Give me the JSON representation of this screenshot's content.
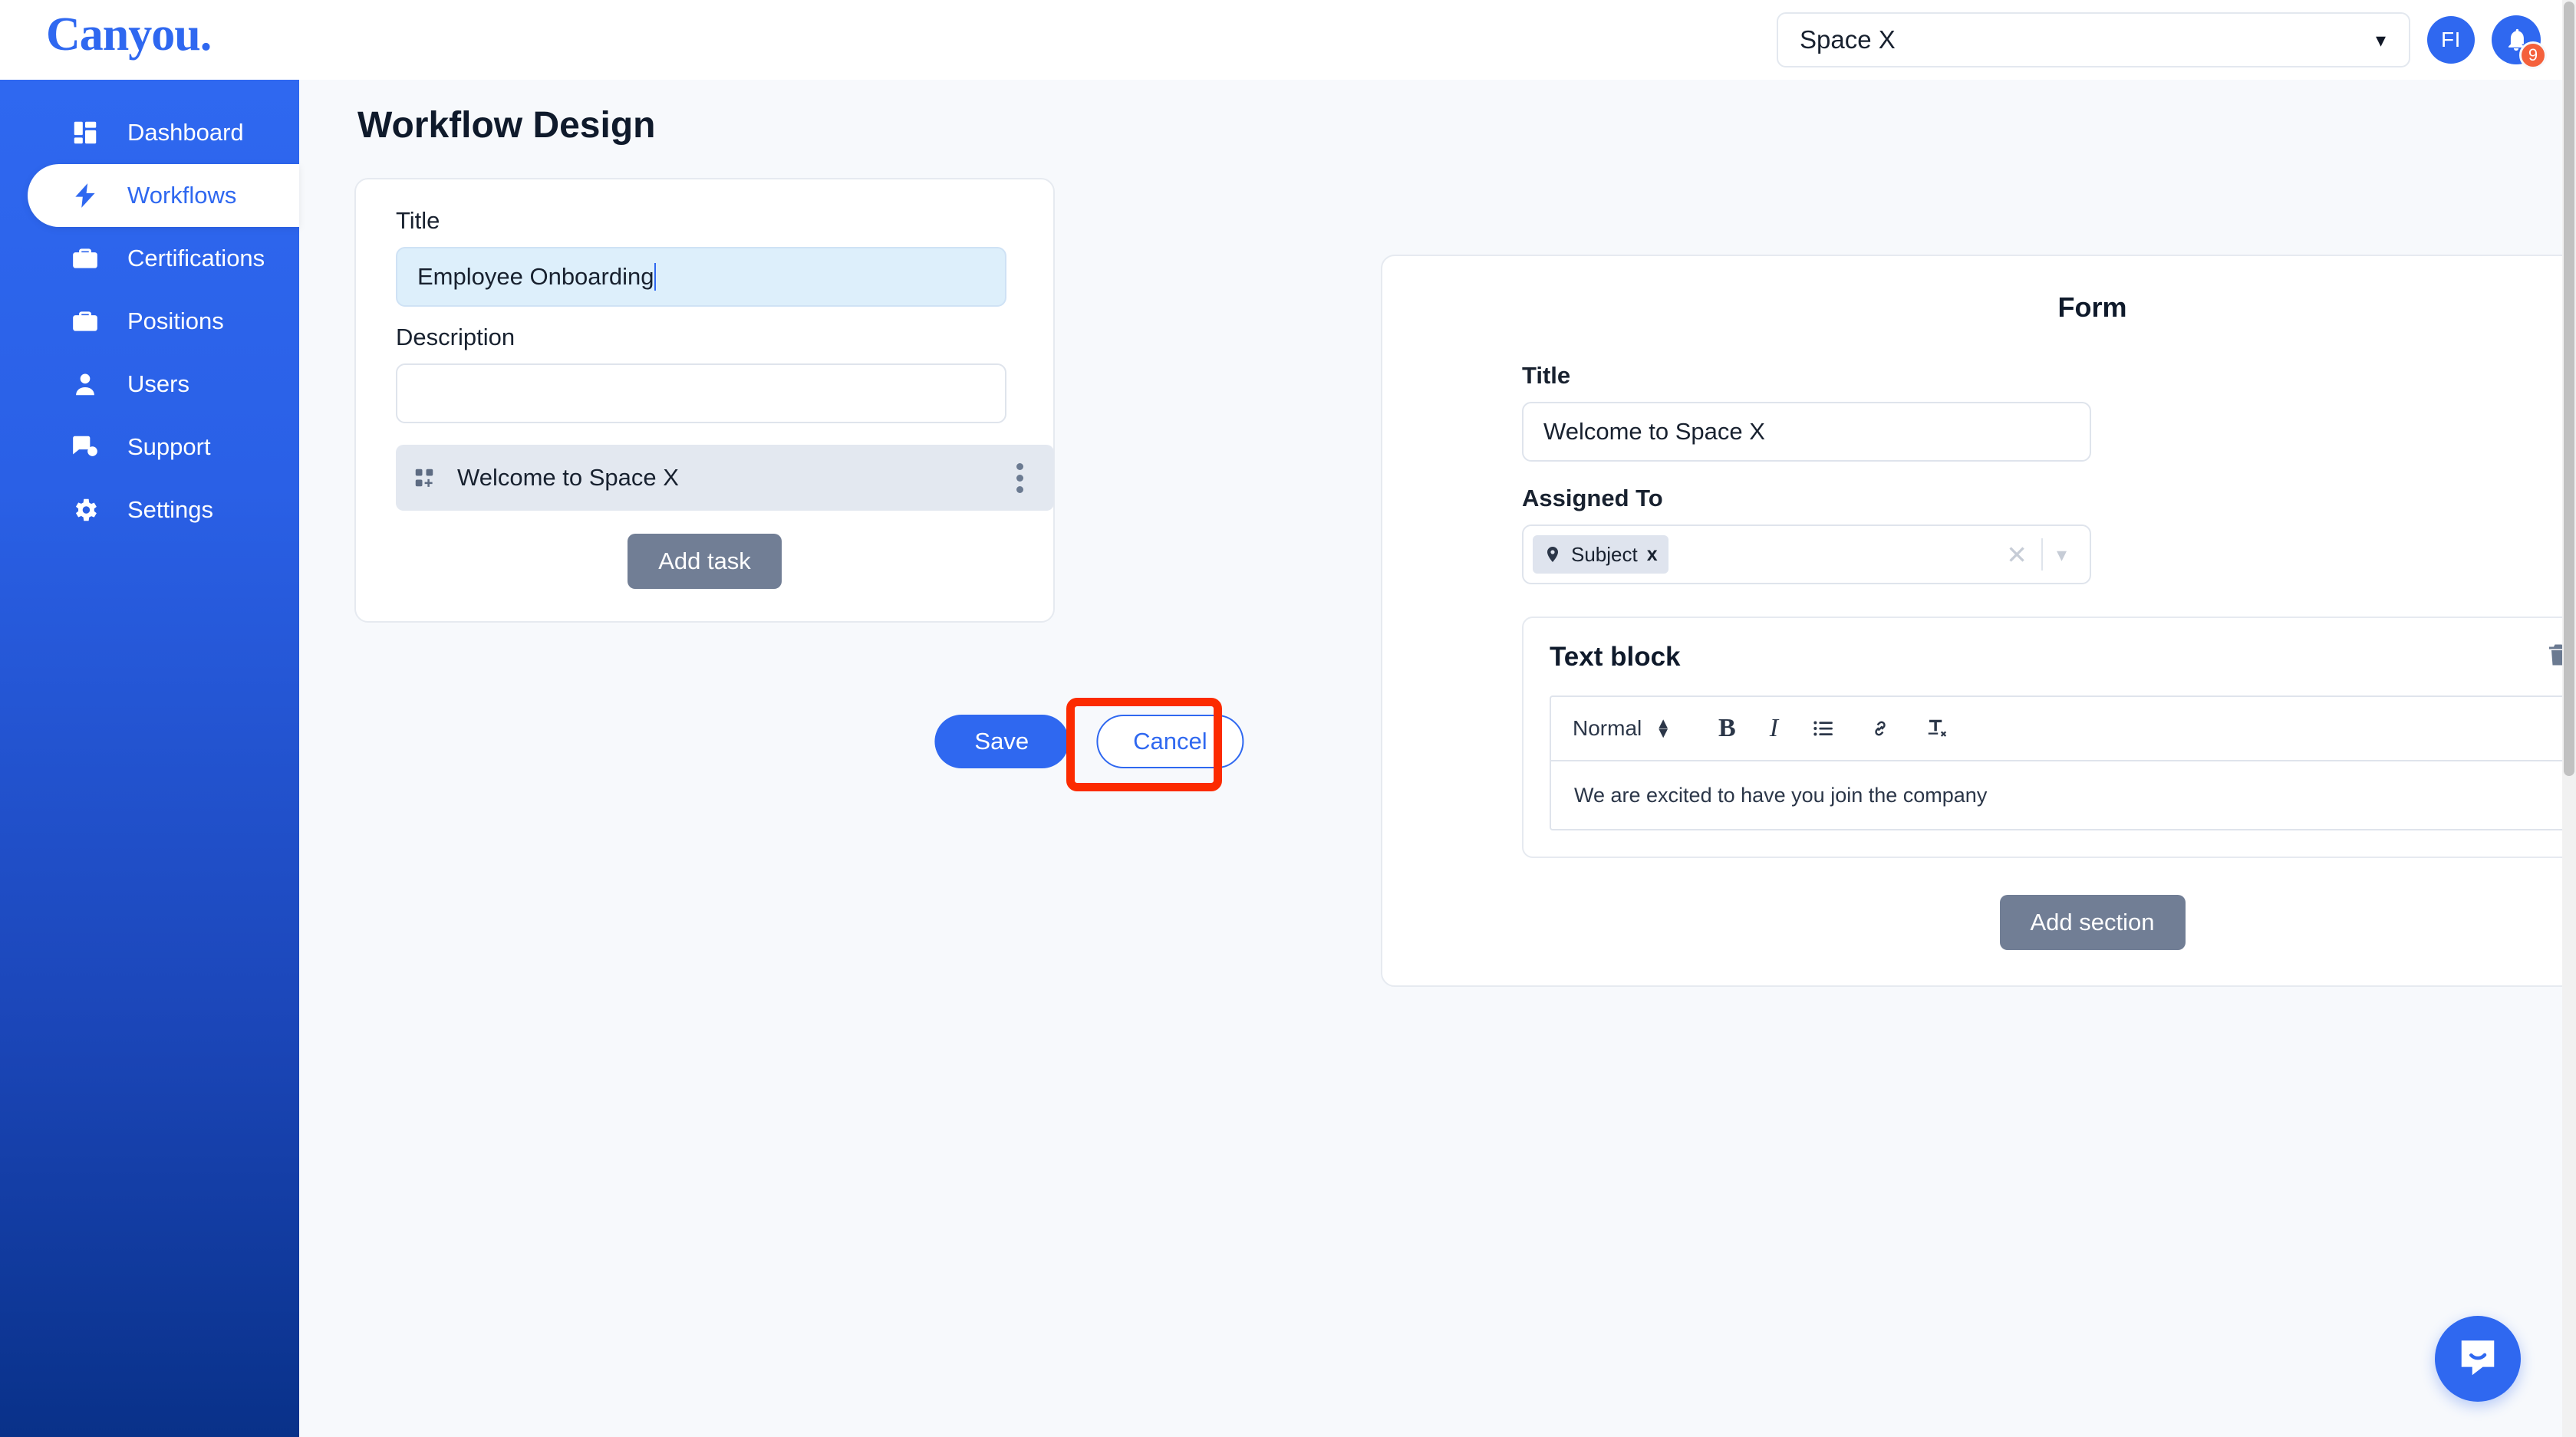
{
  "brand": {
    "logo_text": "Canyou.",
    "accent": "#2f68f0",
    "badge_color": "#f4613c",
    "highlight_color": "#fc2b00"
  },
  "topbar": {
    "org_select_value": "Space X",
    "org_select_chevron": "chevron-down-icon",
    "avatar_initials": "FI",
    "notification_count": "9"
  },
  "sidebar": {
    "items": [
      {
        "label": "Dashboard",
        "icon": "dashboard-grid-icon",
        "active": false
      },
      {
        "label": "Workflows",
        "icon": "lightning-bolt-icon",
        "active": true
      },
      {
        "label": "Certifications",
        "icon": "briefcase-icon",
        "active": false
      },
      {
        "label": "Positions",
        "icon": "briefcase-icon",
        "active": false
      },
      {
        "label": "Users",
        "icon": "user-icon",
        "active": false
      },
      {
        "label": "Support",
        "icon": "chat-question-icon",
        "active": false
      },
      {
        "label": "Settings",
        "icon": "gear-icon",
        "active": false
      }
    ]
  },
  "page": {
    "title": "Workflow Design"
  },
  "workflow": {
    "title_label": "Title",
    "title_value": "Employee Onboarding",
    "description_label": "Description",
    "description_value": "",
    "tasks": [
      {
        "name": "Welcome to Space X",
        "handle_icon": "widget-grid-icon",
        "menu_icon": "kebab-menu-icon"
      }
    ],
    "add_task_label": "Add task",
    "save_label": "Save",
    "cancel_label": "Cancel"
  },
  "form": {
    "heading": "Form",
    "title_label": "Title",
    "title_value": "Welcome to Space X",
    "assigned_label": "Assigned To",
    "assigned_tags": [
      {
        "label": "Subject",
        "icon": "location-pin-icon",
        "remove": "x"
      }
    ],
    "clear_icon": "clear-x-icon",
    "dropdown_icon": "chevron-down-icon",
    "section": {
      "title": "Text block",
      "delete_icon": "trash-icon",
      "drag_icon": "drag-handle-icon",
      "toolbar": {
        "format_value": "Normal",
        "bold_label": "B",
        "italic_label": "I",
        "list_icon": "bullet-list-icon",
        "link_icon": "link-chain-icon",
        "clear_format_label": "Tx"
      },
      "body_text": "We are excited to have you join the company"
    },
    "add_section_label": "Add section"
  },
  "chat": {
    "icon": "chat-bubble-smile-icon"
  }
}
